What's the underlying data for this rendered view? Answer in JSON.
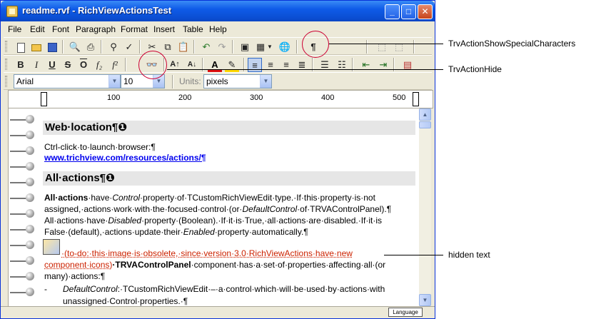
{
  "window": {
    "title": "readme.rvf - RichViewActionsTest",
    "minimize": "_",
    "maximize": "□",
    "close": "✕"
  },
  "menu": [
    "File",
    "Edit",
    "Font",
    "Paragraph",
    "Format",
    "Insert",
    "Table",
    "Help"
  ],
  "toolbar2": {
    "bold": "B",
    "italic": "I",
    "underline": "U",
    "strike": "S",
    "overline": "O",
    "subscript": "f₂",
    "superscript": "f²"
  },
  "toolbar3": {
    "font_name": "Arial",
    "font_size": "10",
    "units_label": "Units:",
    "units_value": "pixels"
  },
  "ruler": {
    "marks": [
      "100",
      "200",
      "300",
      "400",
      "500"
    ]
  },
  "document": {
    "h1": "Web·location¶❶",
    "line1": "Ctrl-click·to·launch·browser:¶",
    "link": "www.trichview.com/resources/actions/¶",
    "h2": "All·actions¶❶",
    "p1_a": "All·actions",
    "p1_b": "·have·",
    "p1_c": "Control",
    "p1_d": "·property·of·TCustomRichViewEdit·type.·If·this·property·is·not",
    "p2_a": "assigned,·actions·work·with·the·focused·control·(or·",
    "p2_b": "DefaultControl",
    "p2_c": "·of·TRVAControlPanel).¶",
    "p3_a": "All·actions·have·",
    "p3_b": "Disabled",
    "p3_c": "·property·(Boolean).·If·it·is·True,·all·actions·are·disabled.·If·it·is",
    "p4_a": "False·(default),·actions·update·their·",
    "p4_b": "Enabled",
    "p4_c": "·property·automatically.¶",
    "p5_hidden": "·(to-do:·this·image·is·obsolete,·since·version·3.0·RichViewActions·have·new",
    "p6_hidden": "component·icons)",
    "p6_bold": "·TRVAControlPanel",
    "p6_rest": "·component·has·a·set·of·properties·affecting·all·(or",
    "p7": "many)·actions:¶",
    "p8_dash": "-",
    "p8_a": "DefaultControl",
    "p8_b": ":·TCustomRichViewEdit·–·a·control·which·will·be·used·by·actions·with",
    "p9": "unassigned·Control·properties.·¶"
  },
  "status": {
    "language": "Language"
  },
  "callouts": {
    "show_special": "TrvActionShowSpecialCharacters",
    "hide": "TrvActionHide",
    "hidden_text": "hidden text"
  },
  "colors": {
    "callout": "#cc0033",
    "hidden_text": "#cc2200",
    "titlebar": "#0b4fd4"
  }
}
